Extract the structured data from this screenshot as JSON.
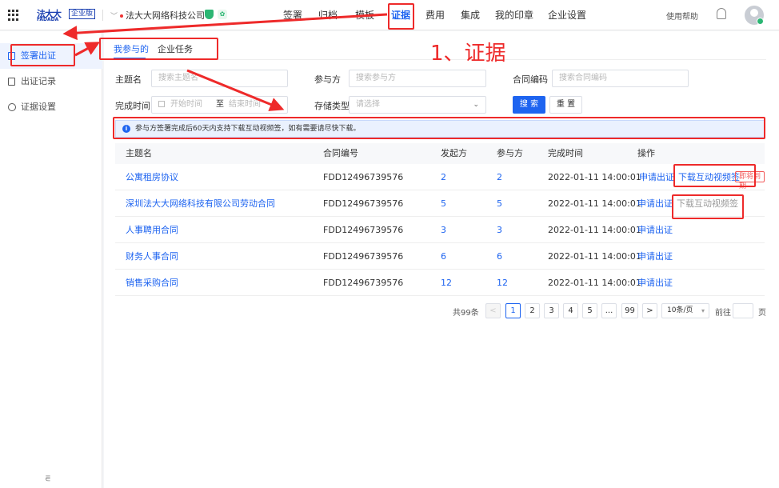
{
  "header": {
    "brand_cn": "法大大",
    "brand_en": "FADADA",
    "edition": "企业版",
    "company": "法大大网络科技公司",
    "leaf_icon": "leaf-icon",
    "nav": [
      "签署",
      "归档",
      "模板",
      "证据",
      "费用",
      "集成",
      "我的印章",
      "企业设置"
    ],
    "active_nav": "证据",
    "help": "使用帮助"
  },
  "sidebar": {
    "items": [
      {
        "label": "签署出证",
        "icon": "file-icon",
        "active": true
      },
      {
        "label": "出证记录",
        "icon": "record-icon",
        "active": false
      },
      {
        "label": "证据设置",
        "icon": "gear-icon",
        "active": false
      }
    ],
    "collapse_icon": "collapse-icon"
  },
  "tabs": [
    "我参与的",
    "企业任务"
  ],
  "filters": {
    "subject_label": "主题名",
    "subject_placeholder": "搜索主题名",
    "party_label": "参与方",
    "party_placeholder": "搜索参与方",
    "code_label": "合同编码",
    "code_placeholder": "搜索合同编码",
    "finish_label": "完成时间",
    "start_placeholder": "开始时间",
    "to": "至",
    "end_placeholder": "结束时间",
    "storage_label": "存储类型",
    "storage_placeholder": "请选择",
    "search_button": "搜 索",
    "reset_button": "重 置"
  },
  "notice": "参与方签署完成后60天内支持下载互动视频签，如有需要请尽快下载。",
  "table": {
    "columns": [
      "主题名",
      "合同编号",
      "发起方",
      "参与方",
      "完成时间",
      "操作"
    ],
    "rows": [
      {
        "subject": "公寓租房协议",
        "code": "FDD12496739576",
        "initiator": "2",
        "party": "2",
        "time": "2022-01-11 14:00:01",
        "action": "申请出证",
        "video": "下载互动视频签",
        "video_enabled": true,
        "tag": "即将到期"
      },
      {
        "subject": "深圳法大大网络科技有限公司劳动合同",
        "code": "FDD12496739576",
        "initiator": "5",
        "party": "5",
        "time": "2022-01-11 14:00:01",
        "action": "申请出证",
        "video": "下载互动视频签",
        "video_enabled": false,
        "tag": ""
      },
      {
        "subject": "人事聘用合同",
        "code": "FDD12496739576",
        "initiator": "3",
        "party": "3",
        "time": "2022-01-11 14:00:01",
        "action": "申请出证",
        "video": "",
        "video_enabled": false,
        "tag": ""
      },
      {
        "subject": "财务人事合同",
        "code": "FDD12496739576",
        "initiator": "6",
        "party": "6",
        "time": "2022-01-11 14:00:01",
        "action": "申请出证",
        "video": "",
        "video_enabled": false,
        "tag": ""
      },
      {
        "subject": "销售采购合同",
        "code": "FDD12496739576",
        "initiator": "12",
        "party": "12",
        "time": "2022-01-11 14:00:01",
        "action": "申请出证",
        "video": "",
        "video_enabled": false,
        "tag": ""
      }
    ]
  },
  "pagination": {
    "total": "共99条",
    "prev": "<",
    "pages": [
      "1",
      "2",
      "3",
      "4",
      "5",
      "...",
      "99"
    ],
    "active": "1",
    "next": ">",
    "size": "10条/页",
    "goto": "前往",
    "page_unit": "页"
  },
  "annotation": {
    "text": "1、证据",
    "color": "#ee2a2a"
  },
  "colors": {
    "primary": "#1e64f0",
    "danger": "#f25a5a",
    "success": "#2bb673"
  }
}
